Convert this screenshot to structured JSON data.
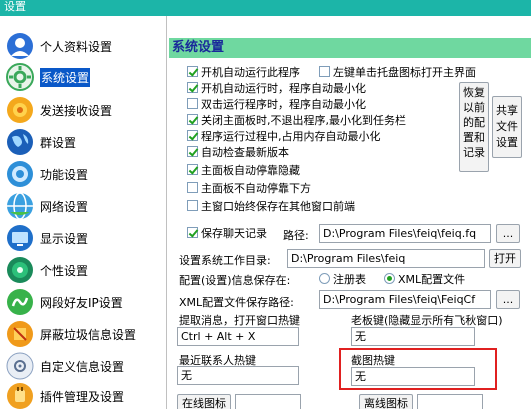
{
  "window": {
    "title": "设置"
  },
  "sidebar": {
    "items": [
      {
        "label": "个人资料设置",
        "icon": "person-icon"
      },
      {
        "label": "系统设置",
        "icon": "gear-icon",
        "active": true
      },
      {
        "label": "发送接收设置",
        "icon": "send-receive-icon"
      },
      {
        "label": "群设置",
        "icon": "globe-icon"
      },
      {
        "label": "功能设置",
        "icon": "function-icon"
      },
      {
        "label": "网络设置",
        "icon": "network-icon"
      },
      {
        "label": "显示设置",
        "icon": "display-icon"
      },
      {
        "label": "个性设置",
        "icon": "personal-icon"
      },
      {
        "label": "网段好友IP设置",
        "icon": "ip-icon"
      },
      {
        "label": "屏蔽垃圾信息设置",
        "icon": "block-icon"
      },
      {
        "label": "自定义信息设置",
        "icon": "custom-info-icon"
      },
      {
        "label": "插件管理及设置",
        "icon": "plugin-icon"
      }
    ]
  },
  "main": {
    "title": "系统设置",
    "options": {
      "autostart": {
        "label": "开机自动运行此程序",
        "checked": true
      },
      "left_click": {
        "label": "左键单击托盘图标打开主界面",
        "checked": false
      },
      "autostart_min": {
        "label": "开机自动运行时，程序自动最小化",
        "checked": true
      },
      "dblclick_min": {
        "label": "双击运行程序时，程序自动最小化",
        "checked": false
      },
      "close_min": {
        "label": "关闭主面板时,不退出程序,最小化到任务栏",
        "checked": true
      },
      "runtime_min": {
        "label": "程序运行过程中,占用内存自动最小化",
        "checked": true
      },
      "auto_update": {
        "label": "自动检查最新版本",
        "checked": true
      },
      "auto_dock": {
        "label": "主面板自动停靠隐藏",
        "checked": true
      },
      "no_dock_bottom": {
        "label": "主面板不自动停靠下方",
        "checked": false
      },
      "always_top": {
        "label": "主窗口始终保存在其他窗口前端",
        "checked": false
      },
      "save_chat": {
        "label": "保存聊天记录",
        "checked": true
      }
    },
    "restore_button": "恢复以前的配置和记录",
    "share_button": "共享文件设置",
    "path_label": "路径:",
    "path_value": "D:\\Program Files\\feiq\\feiq.fq",
    "browse_label": "...",
    "workdir_label": "设置系统工作目录:",
    "workdir_value": "D:\\Program Files\\feiq",
    "open_label": "打开",
    "config_save_label": "配置(设置)信息保存在:",
    "radio_registry": "注册表",
    "radio_xml": "XML配置文件",
    "xml_path_label": "XML配置文件保存路径:",
    "xml_path_value": "D:\\Program Files\\feiq\\FeiqCf",
    "hotkey_fetch_label": "提取消息，打开窗口热键",
    "hotkey_fetch_value": "Ctrl + Alt + X",
    "boss_key_label": "老板键(隐藏显示所有飞秋窗口)",
    "boss_key_value": "无",
    "recent_contact_label": "最近联系人热键",
    "recent_contact_value": "无",
    "screenshot_label": "截图热键",
    "screenshot_value": "无",
    "online_icon_label": "在线图标",
    "offline_icon_label": "离线图标",
    "colors": {
      "accent_bar": "#6fd8a0",
      "active_item": "#0a58c8",
      "highlight": "#e02020",
      "check": "#21a121"
    }
  }
}
